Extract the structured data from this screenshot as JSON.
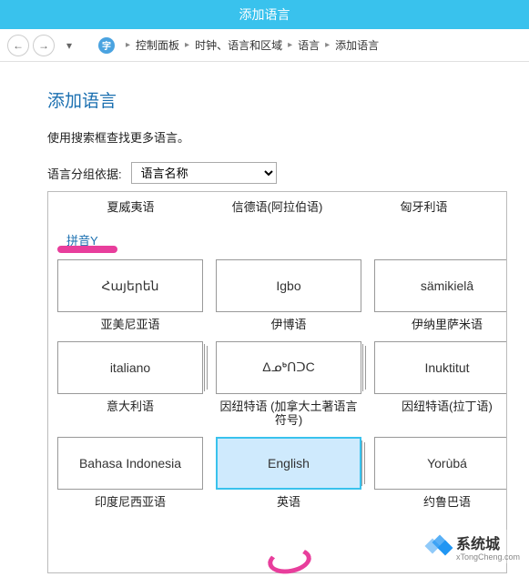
{
  "window": {
    "title": "添加语言"
  },
  "nav": {
    "breadcrumb": [
      "控制面板",
      "时钟、语言和区域",
      "语言",
      "添加语言"
    ]
  },
  "page": {
    "title": "添加语言",
    "hint": "使用搜索框查找更多语言。",
    "group_label": "语言分组依据:",
    "group_value": "语言名称"
  },
  "top_row": [
    "夏威夷语",
    "信德语(阿拉伯语)",
    "匈牙利语"
  ],
  "section_heading": "拼音Y",
  "tiles": [
    {
      "native": "Հայերեն",
      "label": "亚美尼亚语",
      "multi": false,
      "selected": false
    },
    {
      "native": "Igbo",
      "label": "伊博语",
      "multi": false,
      "selected": false
    },
    {
      "native": "sämikielâ",
      "label": "伊纳里萨米语",
      "multi": false,
      "selected": false
    },
    {
      "native": "italiano",
      "label": "意大利语",
      "multi": true,
      "selected": false
    },
    {
      "native": "ΔᓄᒃᑎᑐC",
      "label": "因纽特语 (加拿大土著语言符号)",
      "multi": true,
      "selected": false
    },
    {
      "native": "Inuktitut",
      "label": "因纽特语(拉丁语)",
      "multi": true,
      "selected": false
    },
    {
      "native": "Bahasa Indonesia",
      "label": "印度尼西亚语",
      "multi": false,
      "selected": false
    },
    {
      "native": "English",
      "label": "英语",
      "multi": true,
      "selected": true
    },
    {
      "native": "Yorùbá",
      "label": "约鲁巴语",
      "multi": false,
      "selected": false
    }
  ],
  "watermark": {
    "brand": "系统城",
    "sub": "xTongCheng.com"
  }
}
